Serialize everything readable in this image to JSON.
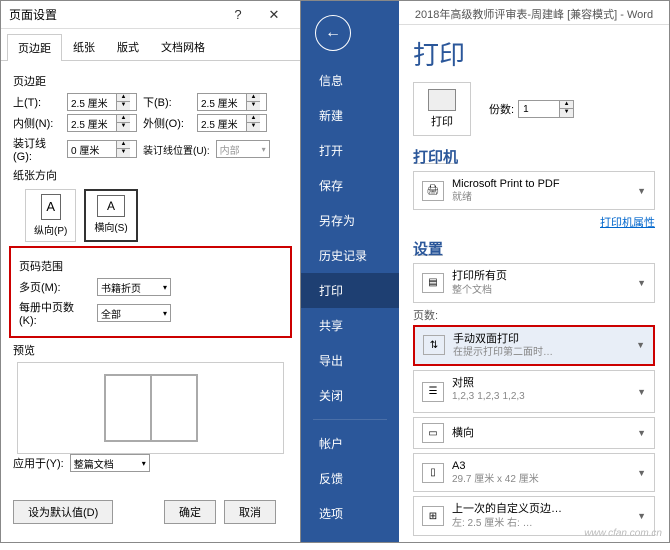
{
  "dialog": {
    "title": "页面设置",
    "help": "?",
    "close": "✕",
    "tabs": [
      "页边距",
      "纸张",
      "版式",
      "文档网格"
    ],
    "margins_label": "页边距",
    "top_label": "上(T):",
    "top_value": "2.5 厘米",
    "bottom_label": "下(B):",
    "bottom_value": "2.5 厘米",
    "inside_label": "内侧(N):",
    "inside_value": "2.5 厘米",
    "outside_label": "外侧(O):",
    "outside_value": "2.5 厘米",
    "gutter_label": "装订线(G):",
    "gutter_value": "0 厘米",
    "gutter_pos_label": "装订线位置(U):",
    "gutter_pos_value": "内部",
    "orient_label": "纸张方向",
    "portrait": "纵向(P)",
    "landscape": "横向(S)",
    "range_label": "页码范围",
    "multipage_label": "多页(M):",
    "multipage_value": "书籍折页",
    "sheets_label": "每册中页数(K):",
    "sheets_value": "全部",
    "preview_label": "预览",
    "applyto_label": "应用于(Y):",
    "applyto_value": "整篇文档",
    "set_default": "设为默认值(D)",
    "ok": "确定",
    "cancel": "取消"
  },
  "sidebar": {
    "items": [
      "信息",
      "新建",
      "打开",
      "保存",
      "另存为",
      "历史记录",
      "打印",
      "共享",
      "导出",
      "关闭",
      "帐户",
      "反馈",
      "选项"
    ]
  },
  "print": {
    "app_title": "2018年高级教师评审表-周建峰 [兼容模式] - Word",
    "heading": "打印",
    "print_button": "打印",
    "copies_label": "份数:",
    "copies_value": "1",
    "printer_heading": "打印机",
    "printer_name": "Microsoft Print to PDF",
    "printer_status": "就绪",
    "printer_props": "打印机属性",
    "settings_heading": "设置",
    "print_all": "打印所有页",
    "print_all_sub": "整个文档",
    "pages_label": "页数:",
    "duplex": "手动双面打印",
    "duplex_sub": "在提示打印第二面时…",
    "collate": "对照",
    "collate_opts": [
      "1,2,3",
      "1,2,3",
      "1,2,3"
    ],
    "orient": "横向",
    "paper": "A3",
    "paper_sub": "29.7 厘米 x 42 厘米",
    "margins_last": "上一次的自定义页边…",
    "margins_last_sub": "左: 2.5 厘米 右: …"
  },
  "watermark": "www.cfan.com.cn"
}
